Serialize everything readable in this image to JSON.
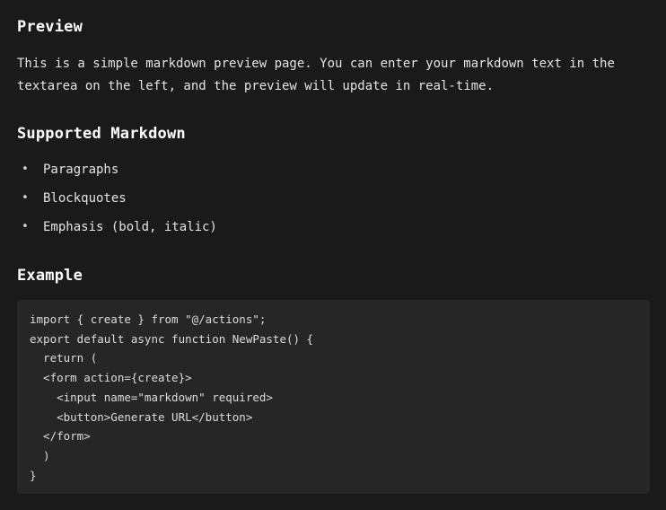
{
  "preview": {
    "title": "Preview",
    "intro": "This is a simple markdown preview page. You can enter your markdown text in the textarea on the left, and the preview will update in real-time."
  },
  "supported": {
    "title": "Supported Markdown",
    "bullet": "•",
    "items": [
      {
        "label": "Paragraphs"
      },
      {
        "label": "Blockquotes"
      },
      {
        "label": "Emphasis (bold, italic)"
      }
    ]
  },
  "example": {
    "title": "Example",
    "code_lines": [
      "import { create } from \"@/actions\";",
      "export default async function NewPaste() {",
      "  return (",
      "  <form action={create}>",
      "    <input name=\"markdown\" required>",
      "    <button>Generate URL</button>",
      "  </form>",
      "  )",
      "}"
    ]
  }
}
